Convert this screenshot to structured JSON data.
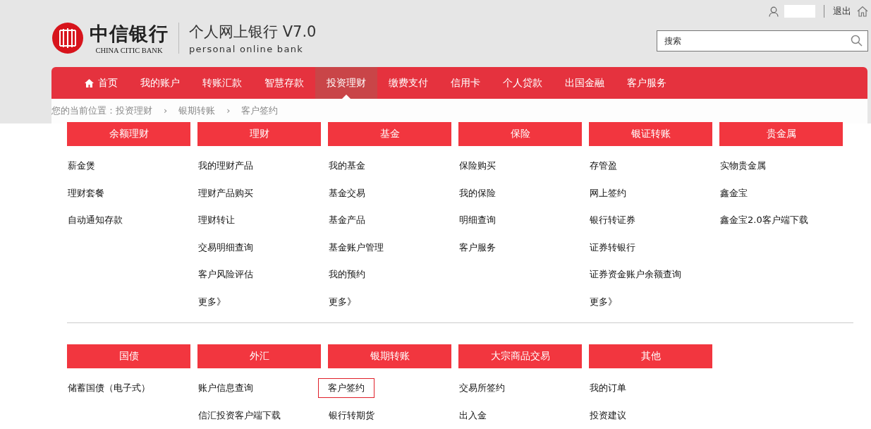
{
  "header": {
    "bank_name": "中信银行",
    "bank_name_en": "CHINA CITIC BANK",
    "product": "个人网上银行 V7.0",
    "product_en": "personal online bank",
    "logout": "退出",
    "search": {
      "placeholder": "搜索"
    }
  },
  "nav": [
    {
      "label": "首页",
      "kind": "home",
      "selected": false
    },
    {
      "label": "我的账户",
      "kind": "plain",
      "selected": false
    },
    {
      "label": "转账汇款",
      "kind": "plain",
      "selected": false
    },
    {
      "label": "智慧存款",
      "kind": "plain",
      "selected": false
    },
    {
      "label": "投资理财",
      "kind": "plain",
      "selected": true
    },
    {
      "label": "缴费支付",
      "kind": "plain",
      "selected": false
    },
    {
      "label": "信用卡",
      "kind": "plain",
      "selected": false
    },
    {
      "label": "个人贷款",
      "kind": "plain",
      "selected": false
    },
    {
      "label": "出国金融",
      "kind": "plain",
      "selected": false
    },
    {
      "label": "客户服务",
      "kind": "plain",
      "selected": false
    }
  ],
  "breadcrumb": {
    "separator": "›",
    "items": [
      "您的当前位置：投资理财",
      "银期转账",
      "客户签约"
    ]
  },
  "menu_sections": [
    {
      "categories": [
        {
          "title": "余额理财",
          "items": [
            {
              "label": "薪金煲",
              "selected": false
            },
            {
              "label": "理财套餐",
              "selected": false
            },
            {
              "label": "自动通知存款",
              "selected": false
            }
          ]
        },
        {
          "title": "理财",
          "items": [
            {
              "label": "我的理财产品",
              "selected": false
            },
            {
              "label": "理财产品购买",
              "selected": false
            },
            {
              "label": "理财转让",
              "selected": false
            },
            {
              "label": "交易明细查询",
              "selected": false
            },
            {
              "label": "客户风险评估",
              "selected": false
            },
            {
              "label": "更多》",
              "selected": false
            }
          ]
        },
        {
          "title": "基金",
          "items": [
            {
              "label": "我的基金",
              "selected": false
            },
            {
              "label": "基金交易",
              "selected": false
            },
            {
              "label": "基金产品",
              "selected": false
            },
            {
              "label": "基金账户管理",
              "selected": false
            },
            {
              "label": "我的预约",
              "selected": false
            },
            {
              "label": "更多》",
              "selected": false
            }
          ]
        },
        {
          "title": "保险",
          "items": [
            {
              "label": "保险购买",
              "selected": false
            },
            {
              "label": "我的保险",
              "selected": false
            },
            {
              "label": "明细查询",
              "selected": false
            },
            {
              "label": "客户服务",
              "selected": false
            }
          ]
        },
        {
          "title": "银证转账",
          "items": [
            {
              "label": "存管盈",
              "selected": false
            },
            {
              "label": "网上签约",
              "selected": false
            },
            {
              "label": "银行转证券",
              "selected": false
            },
            {
              "label": "证券转银行",
              "selected": false
            },
            {
              "label": "证券资金账户余额查询",
              "selected": false
            },
            {
              "label": "更多》",
              "selected": false
            }
          ]
        },
        {
          "title": "贵金属",
          "items": [
            {
              "label": "实物贵金属",
              "selected": false
            },
            {
              "label": "鑫金宝",
              "selected": false
            },
            {
              "label": "鑫金宝2.0客户端下载",
              "selected": false
            }
          ]
        }
      ]
    },
    {
      "categories": [
        {
          "title": "国债",
          "items": [
            {
              "label": "储蓄国债（电子式）",
              "selected": false
            }
          ]
        },
        {
          "title": "外汇",
          "items": [
            {
              "label": "账户信息查询",
              "selected": false
            },
            {
              "label": "信汇投资客户端下载",
              "selected": false
            }
          ]
        },
        {
          "title": "银期转账",
          "items": [
            {
              "label": "客户签约",
              "selected": true
            },
            {
              "label": "银行转期货",
              "selected": false
            }
          ]
        },
        {
          "title": "大宗商品交易",
          "items": [
            {
              "label": "交易所签约",
              "selected": false
            },
            {
              "label": "出入金",
              "selected": false
            }
          ]
        },
        {
          "title": "其他",
          "items": [
            {
              "label": "我的订单",
              "selected": false
            },
            {
              "label": "投资建议",
              "selected": false
            }
          ]
        }
      ]
    }
  ]
}
